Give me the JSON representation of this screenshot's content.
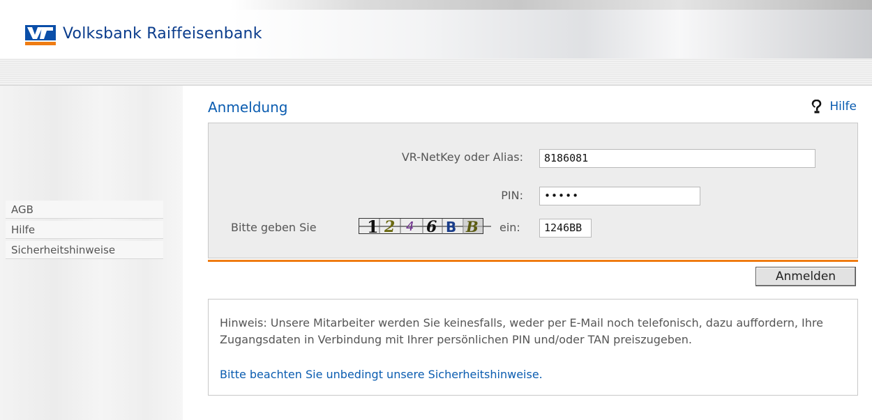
{
  "header": {
    "bank_name": "Volksbank Raiffeisenbank",
    "logo_icon": "vr-bank-logo-icon"
  },
  "sidebar": {
    "items": [
      {
        "label": "AGB"
      },
      {
        "label": "Hilfe"
      },
      {
        "label": "Sicherheitshinweise"
      }
    ]
  },
  "main": {
    "title": "Anmeldung",
    "help_label": "Hilfe",
    "help_icon": "help-question-icon"
  },
  "form": {
    "netkey_label": "VR-NetKey oder Alias:",
    "netkey_value": "8186081",
    "pin_label": "PIN:",
    "pin_value": "•••••",
    "captcha_prefix": "Bitte geben Sie",
    "captcha_text": "1246BB",
    "captcha_suffix": "ein:",
    "captcha_value": "1246BB",
    "submit_label": "Anmelden"
  },
  "notice": {
    "text": "Hinweis: Unsere Mitarbeiter werden Sie keinesfalls, weder per E-Mail noch telefonisch, dazu auffordern, Ihre Zugangsdaten in Verbindung mit Ihrer persönlichen PIN und/oder TAN preiszugeben.",
    "link": "Bitte beachten Sie unbedingt unsere Sicherheitshinweise."
  },
  "colors": {
    "brand_blue": "#0a3c8c",
    "link_blue": "#0a5cb0",
    "accent_orange": "#ef7c13",
    "panel_gray": "#ededed"
  }
}
